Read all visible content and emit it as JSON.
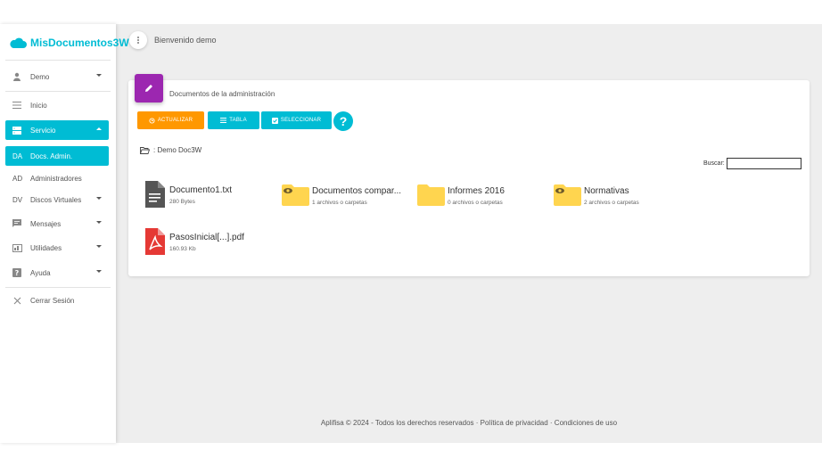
{
  "app": {
    "name": "MisDocumentos3W"
  },
  "header": {
    "welcome": "Bienvenido demo"
  },
  "sidebar": {
    "user": "Demo",
    "items": [
      {
        "label": "Inicio",
        "icon": "menu-icon"
      },
      {
        "label": "Servicio",
        "icon": "server-icon"
      },
      {
        "label": "Docs. Admin.",
        "abbr": "DA"
      },
      {
        "label": "Administradores",
        "abbr": "AD"
      },
      {
        "label": "Discos Virtuales",
        "abbr": "DV"
      },
      {
        "label": "Mensajes",
        "icon": "chat-icon"
      },
      {
        "label": "Utilidades",
        "icon": "tools-icon"
      },
      {
        "label": "Ayuda",
        "icon": "help-icon"
      },
      {
        "label": "Cerrar Sesión",
        "icon": "close-icon"
      }
    ]
  },
  "card": {
    "title": "Documentos de la administración",
    "buttons": {
      "refresh": "ACTUALIZAR",
      "table": "TABLA",
      "select": "SELECCIONAR",
      "help": "?"
    },
    "path": ": Demo Doc3W",
    "search_label": "Buscar:",
    "search_value": ""
  },
  "files": [
    {
      "name": "Documento1.txt",
      "meta": "280 Bytes",
      "icon": "text-file-icon"
    },
    {
      "name": "Documentos compar...",
      "meta": "1 archivos o carpetas",
      "icon": "shared-folder-icon"
    },
    {
      "name": "Informes 2016",
      "meta": "0 archivos o carpetas",
      "icon": "folder-icon"
    },
    {
      "name": "Normativas",
      "meta": "2 archivos o carpetas",
      "icon": "shared-folder-icon"
    },
    {
      "name": "PasosInicial[...].pdf",
      "meta": "160.93 Kb",
      "icon": "pdf-file-icon"
    }
  ],
  "footer": {
    "text": "Aplifisa © 2024 - Todos los derechos reservados · Política de privacidad · Condiciones de uso"
  },
  "colors": {
    "accent": "#00bcd4",
    "orange": "#ff9800",
    "purple": "#9c27b0",
    "folder": "#ffd54f",
    "pdf": "#e53935"
  }
}
